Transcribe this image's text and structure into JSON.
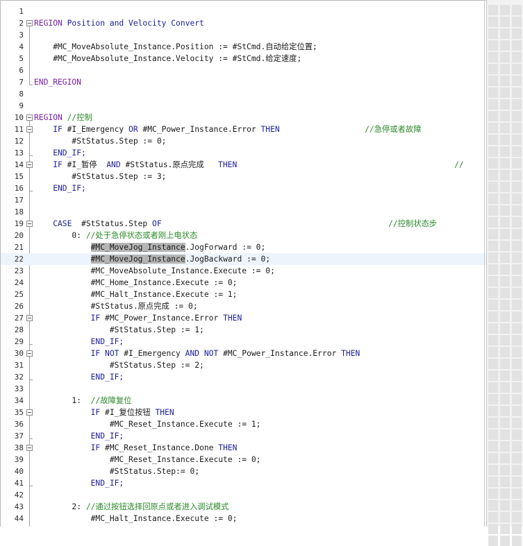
{
  "editor": {
    "current_line": 22,
    "lines": [
      {
        "n": "1",
        "fold": "none",
        "parts": []
      },
      {
        "n": "2",
        "fold": "open",
        "parts": [
          {
            "c": "kw",
            "t": "REGION"
          },
          {
            "c": "kwb",
            "t": " Position and Velocity Convert"
          }
        ]
      },
      {
        "n": "3",
        "fold": "none",
        "parts": []
      },
      {
        "n": "4",
        "fold": "none",
        "parts": [
          {
            "c": "",
            "t": "    #MC_MoveAbsolute_Instance.Position := #StCmd.自动给定位置;"
          }
        ]
      },
      {
        "n": "5",
        "fold": "none",
        "parts": [
          {
            "c": "",
            "t": "    #MC_MoveAbsolute_Instance.Velocity := #StCmd.给定速度;"
          }
        ]
      },
      {
        "n": "6",
        "fold": "none",
        "parts": []
      },
      {
        "n": "7",
        "fold": "end",
        "parts": [
          {
            "c": "kw",
            "t": "END_REGION"
          }
        ]
      },
      {
        "n": "8",
        "fold": "none",
        "parts": []
      },
      {
        "n": "9",
        "fold": "none",
        "parts": []
      },
      {
        "n": "10",
        "fold": "open",
        "parts": [
          {
            "c": "kw",
            "t": "REGION"
          },
          {
            "c": "cm",
            "t": " //控制"
          }
        ]
      },
      {
        "n": "11",
        "fold": "open",
        "parts": [
          {
            "c": "kwb",
            "t": "    IF "
          },
          {
            "c": "",
            "t": "#I_Emergency "
          },
          {
            "c": "kwb",
            "t": "OR "
          },
          {
            "c": "",
            "t": "#MC_Power_Instance.Error "
          },
          {
            "c": "kwb",
            "t": "THEN"
          },
          {
            "c": "cm",
            "t": "                  //急停或者故障"
          }
        ]
      },
      {
        "n": "12",
        "fold": "none",
        "parts": [
          {
            "c": "",
            "t": "        #StStatus.Step := 0;"
          }
        ]
      },
      {
        "n": "13",
        "fold": "end",
        "parts": [
          {
            "c": "kwb",
            "t": "    END_IF;"
          }
        ]
      },
      {
        "n": "14",
        "fold": "open",
        "parts": [
          {
            "c": "kwb",
            "t": "    IF "
          },
          {
            "c": "",
            "t": "#I_暂停  "
          },
          {
            "c": "kwb",
            "t": "AND "
          },
          {
            "c": "",
            "t": "#StStatus.原点完成   "
          },
          {
            "c": "kwb",
            "t": "THEN"
          },
          {
            "c": "cm",
            "t": "                                              //"
          }
        ]
      },
      {
        "n": "15",
        "fold": "none",
        "parts": [
          {
            "c": "",
            "t": "        #StStatus.Step := 3;"
          }
        ]
      },
      {
        "n": "16",
        "fold": "end",
        "parts": [
          {
            "c": "kwb",
            "t": "    END_IF;"
          }
        ]
      },
      {
        "n": "17",
        "fold": "none",
        "parts": []
      },
      {
        "n": "18",
        "fold": "none",
        "parts": []
      },
      {
        "n": "19",
        "fold": "open",
        "parts": [
          {
            "c": "kwb",
            "t": "    CASE  "
          },
          {
            "c": "",
            "t": "#StStatus.Step "
          },
          {
            "c": "kwb",
            "t": "OF"
          },
          {
            "c": "cm",
            "t": "                                                //控制状态步"
          }
        ]
      },
      {
        "n": "20",
        "fold": "none",
        "parts": [
          {
            "c": "",
            "t": "        0: "
          },
          {
            "c": "cm",
            "t": "//处于急停状态或者刚上电状态"
          }
        ]
      },
      {
        "n": "21",
        "fold": "none",
        "parts": [
          {
            "c": "",
            "t": "            "
          },
          {
            "c": "hl",
            "t": "#MC_MoveJog_Instance"
          },
          {
            "c": "",
            "t": ".JogForward := 0;"
          }
        ]
      },
      {
        "n": "22",
        "fold": "none",
        "parts": [
          {
            "c": "",
            "t": "            "
          },
          {
            "c": "hl",
            "t": "#MC_MoveJog_Instance"
          },
          {
            "c": "",
            "t": ".JogBackward := 0;"
          }
        ]
      },
      {
        "n": "23",
        "fold": "none",
        "parts": [
          {
            "c": "",
            "t": "            #MC_MoveAbsolute_Instance.Execute := 0;"
          }
        ]
      },
      {
        "n": "24",
        "fold": "none",
        "parts": [
          {
            "c": "",
            "t": "            #MC_Home_Instance.Execute := 0;"
          }
        ]
      },
      {
        "n": "25",
        "fold": "none",
        "parts": [
          {
            "c": "",
            "t": "            #MC_Halt_Instance.Execute := 1;"
          }
        ]
      },
      {
        "n": "26",
        "fold": "none",
        "parts": [
          {
            "c": "",
            "t": "            #StStatus.原点完成 := 0;"
          }
        ]
      },
      {
        "n": "27",
        "fold": "open",
        "parts": [
          {
            "c": "kwb",
            "t": "            IF "
          },
          {
            "c": "",
            "t": "#MC_Power_Instance.Error "
          },
          {
            "c": "kwb",
            "t": "THEN"
          }
        ]
      },
      {
        "n": "28",
        "fold": "none",
        "parts": [
          {
            "c": "",
            "t": "                #StStatus.Step := 1;"
          }
        ]
      },
      {
        "n": "29",
        "fold": "end",
        "parts": [
          {
            "c": "kwb",
            "t": "            END_IF;"
          }
        ]
      },
      {
        "n": "30",
        "fold": "open",
        "parts": [
          {
            "c": "kwb",
            "t": "            IF NOT "
          },
          {
            "c": "",
            "t": "#I_Emergency "
          },
          {
            "c": "kwb",
            "t": "AND NOT "
          },
          {
            "c": "",
            "t": "#MC_Power_Instance.Error "
          },
          {
            "c": "kwb",
            "t": "THEN"
          }
        ]
      },
      {
        "n": "31",
        "fold": "none",
        "parts": [
          {
            "c": "",
            "t": "                #StStatus.Step := 2;"
          }
        ]
      },
      {
        "n": "32",
        "fold": "end",
        "parts": [
          {
            "c": "kwb",
            "t": "            END_IF;"
          }
        ]
      },
      {
        "n": "33",
        "fold": "none",
        "parts": []
      },
      {
        "n": "34",
        "fold": "none",
        "parts": [
          {
            "c": "",
            "t": "        1:  "
          },
          {
            "c": "cm",
            "t": "//故障复位"
          }
        ]
      },
      {
        "n": "35",
        "fold": "open",
        "parts": [
          {
            "c": "kwb",
            "t": "            IF "
          },
          {
            "c": "",
            "t": "#I_复位按钮 "
          },
          {
            "c": "kwb",
            "t": "THEN"
          }
        ]
      },
      {
        "n": "36",
        "fold": "none",
        "parts": [
          {
            "c": "",
            "t": "                #MC_Reset_Instance.Execute := 1;"
          }
        ]
      },
      {
        "n": "37",
        "fold": "end",
        "parts": [
          {
            "c": "kwb",
            "t": "            END_IF;"
          }
        ]
      },
      {
        "n": "38",
        "fold": "open",
        "parts": [
          {
            "c": "kwb",
            "t": "            IF "
          },
          {
            "c": "",
            "t": "#MC_Reset_Instance.Done "
          },
          {
            "c": "kwb",
            "t": "THEN"
          }
        ]
      },
      {
        "n": "39",
        "fold": "none",
        "parts": [
          {
            "c": "",
            "t": "                #MC_Reset_Instance.Execute := 0;"
          }
        ]
      },
      {
        "n": "40",
        "fold": "none",
        "parts": [
          {
            "c": "",
            "t": "                #StStatus.Step:= 0;"
          }
        ]
      },
      {
        "n": "41",
        "fold": "end",
        "parts": [
          {
            "c": "kwb",
            "t": "            END_IF;"
          }
        ]
      },
      {
        "n": "42",
        "fold": "none",
        "parts": []
      },
      {
        "n": "43",
        "fold": "none",
        "parts": [
          {
            "c": "",
            "t": "        2: "
          },
          {
            "c": "cm",
            "t": "//通过按钮选择回原点或者进入调试模式"
          }
        ]
      },
      {
        "n": "44",
        "fold": "none",
        "parts": [
          {
            "c": "",
            "t": "            #MC_Halt_Instance.Execute := 0;"
          }
        ]
      }
    ]
  }
}
